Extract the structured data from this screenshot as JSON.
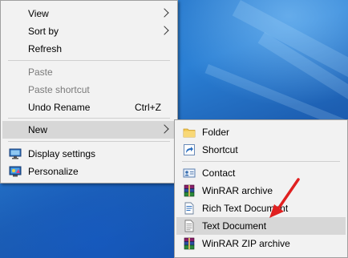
{
  "context_menu": {
    "items": [
      {
        "label": "View",
        "submenu": true
      },
      {
        "label": "Sort by",
        "submenu": true
      },
      {
        "label": "Refresh"
      },
      {
        "label": "Paste",
        "disabled": true
      },
      {
        "label": "Paste shortcut",
        "disabled": true
      },
      {
        "label": "Undo Rename",
        "shortcut": "Ctrl+Z"
      },
      {
        "label": "New",
        "submenu": true,
        "selected": true
      },
      {
        "label": "Display settings",
        "icon": "display-settings-icon"
      },
      {
        "label": "Personalize",
        "icon": "personalize-icon"
      }
    ]
  },
  "new_submenu": {
    "items": [
      {
        "label": "Folder",
        "icon": "folder-icon"
      },
      {
        "label": "Shortcut",
        "icon": "shortcut-icon"
      },
      {
        "label": "Contact",
        "icon": "contact-icon"
      },
      {
        "label": "WinRAR archive",
        "icon": "winrar-archive-icon"
      },
      {
        "label": "Rich Text Document",
        "icon": "rich-text-document-icon"
      },
      {
        "label": "Text Document",
        "icon": "text-document-icon",
        "selected": true
      },
      {
        "label": "WinRAR ZIP archive",
        "icon": "winrar-zip-icon"
      }
    ]
  },
  "colors": {
    "menu_background": "#f2f2f2",
    "selected_background": "#d7d7d7",
    "disabled_text": "#7a7a7a",
    "annotation_arrow": "#e02020"
  }
}
